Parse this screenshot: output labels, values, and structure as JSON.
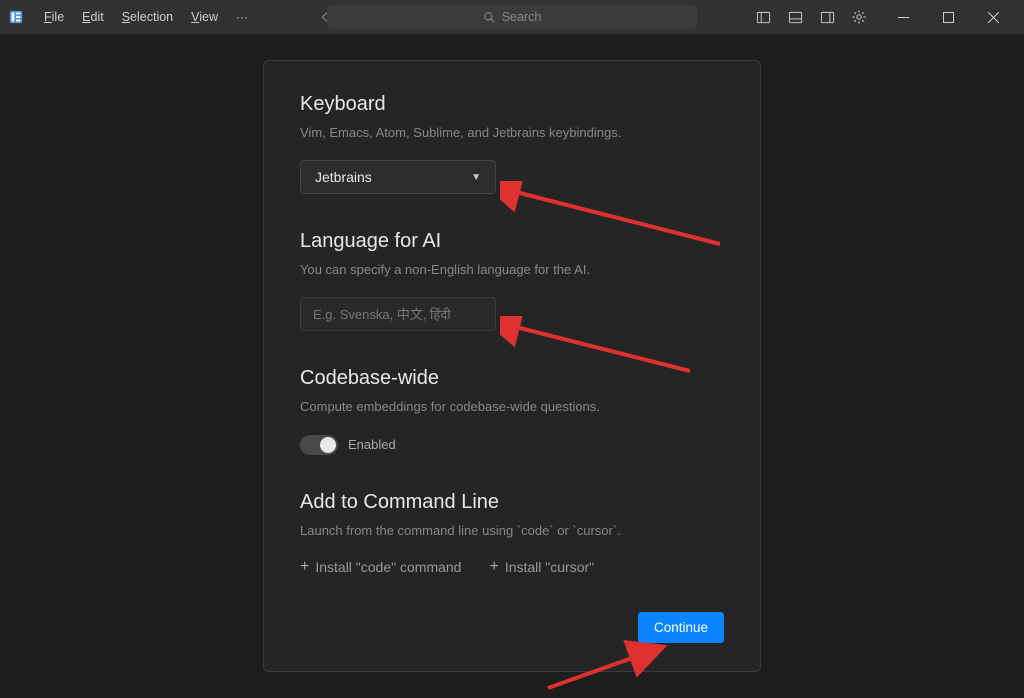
{
  "menu": {
    "file": "File",
    "edit": "Edit",
    "selection": "Selection",
    "view": "View"
  },
  "search": {
    "placeholder": "Search"
  },
  "settings": {
    "keyboard": {
      "title": "Keyboard",
      "desc": "Vim, Emacs, Atom, Sublime, and Jetbrains keybindings.",
      "selected": "Jetbrains"
    },
    "language": {
      "title": "Language for AI",
      "desc": "You can specify a non-English language for the AI.",
      "placeholder": "E.g. Svenska, 中文, हिंदी"
    },
    "codebase": {
      "title": "Codebase-wide",
      "desc": "Compute embeddings for codebase-wide questions.",
      "toggle_label": "Enabled"
    },
    "cli": {
      "title": "Add to Command Line",
      "desc": "Launch from the command line using `code` or `cursor`.",
      "install_code": "Install \"code\" command",
      "install_cursor": "Install \"cursor\""
    },
    "continue_label": "Continue"
  }
}
